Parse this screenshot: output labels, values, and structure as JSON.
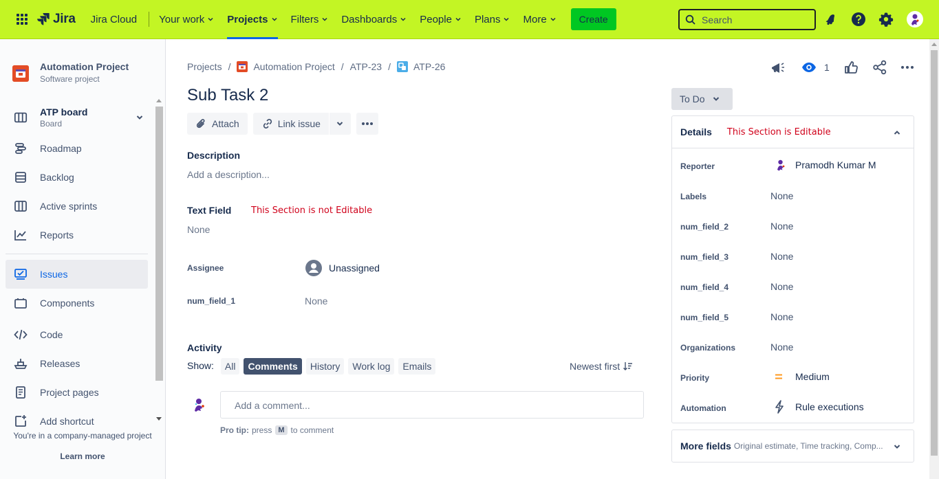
{
  "topnav": {
    "logo_text": "Jira",
    "app_name": "Jira Cloud",
    "items": [
      {
        "label": "Your work",
        "active": false
      },
      {
        "label": "Projects",
        "active": true
      },
      {
        "label": "Filters",
        "active": false
      },
      {
        "label": "Dashboards",
        "active": false
      },
      {
        "label": "People",
        "active": false
      },
      {
        "label": "Plans",
        "active": false
      },
      {
        "label": "More",
        "active": false
      }
    ],
    "create_label": "Create",
    "search_placeholder": "Search"
  },
  "sidebar": {
    "project_name": "Automation Project",
    "project_type": "Software project",
    "board_title": "ATP board",
    "board_sub": "Board",
    "items": [
      {
        "label": "Roadmap",
        "icon": "roadmap-icon"
      },
      {
        "label": "Backlog",
        "icon": "backlog-icon"
      },
      {
        "label": "Active sprints",
        "icon": "sprints-icon"
      },
      {
        "label": "Reports",
        "icon": "reports-icon"
      },
      {
        "label": "Issues",
        "icon": "issues-icon",
        "selected": true
      },
      {
        "label": "Components",
        "icon": "components-icon"
      },
      {
        "label": "Code",
        "icon": "code-icon"
      },
      {
        "label": "Releases",
        "icon": "releases-icon"
      },
      {
        "label": "Project pages",
        "icon": "pages-icon"
      },
      {
        "label": "Add shortcut",
        "icon": "add-shortcut-icon"
      }
    ],
    "footer_text": "You're in a company-managed project",
    "learn_more": "Learn more"
  },
  "breadcrumb": {
    "projects": "Projects",
    "project": "Automation Project",
    "parent": "ATP-23",
    "current": "ATP-26"
  },
  "issue": {
    "title": "Sub Task 2",
    "attach_label": "Attach",
    "link_issue_label": "Link issue",
    "description_heading": "Description",
    "description_placeholder": "Add a description...",
    "text_field_heading": "Text Field",
    "text_field_note": "This Section is not Editable",
    "text_field_value": "None",
    "assignee_label": "Assignee",
    "assignee_value": "Unassigned",
    "num_field_1_label": "num_field_1",
    "num_field_1_value": "None"
  },
  "activity": {
    "heading": "Activity",
    "show_label": "Show:",
    "tabs": [
      "All",
      "Comments",
      "History",
      "Work log",
      "Emails"
    ],
    "active_tab": "Comments",
    "sort_label": "Newest first",
    "comment_placeholder": "Add a comment...",
    "protip_prefix": "Pro tip:",
    "protip_press": "press",
    "protip_key": "M",
    "protip_suffix": "to comment"
  },
  "right": {
    "watch_count": "1",
    "status": "To Do",
    "details_title": "Details",
    "details_note": "This Section is Editable",
    "fields": [
      {
        "label": "Reporter",
        "value": "Pramodh Kumar M"
      },
      {
        "label": "Labels",
        "value": "None"
      },
      {
        "label": "num_field_2",
        "value": "None"
      },
      {
        "label": "num_field_3",
        "value": "None"
      },
      {
        "label": "num_field_4",
        "value": "None"
      },
      {
        "label": "num_field_5",
        "value": "None"
      },
      {
        "label": "Organizations",
        "value": "None"
      },
      {
        "label": "Priority",
        "value": "Medium"
      },
      {
        "label": "Automation",
        "value": "Rule executions"
      }
    ],
    "more_fields_title": "More fields",
    "more_fields_sub": "Original estimate, Time tracking, Comp..."
  },
  "colors": {
    "nav_bg": "#c3f524",
    "create_bg": "#00c722",
    "accent": "#0c66e4",
    "note_red": "#d0021b"
  }
}
